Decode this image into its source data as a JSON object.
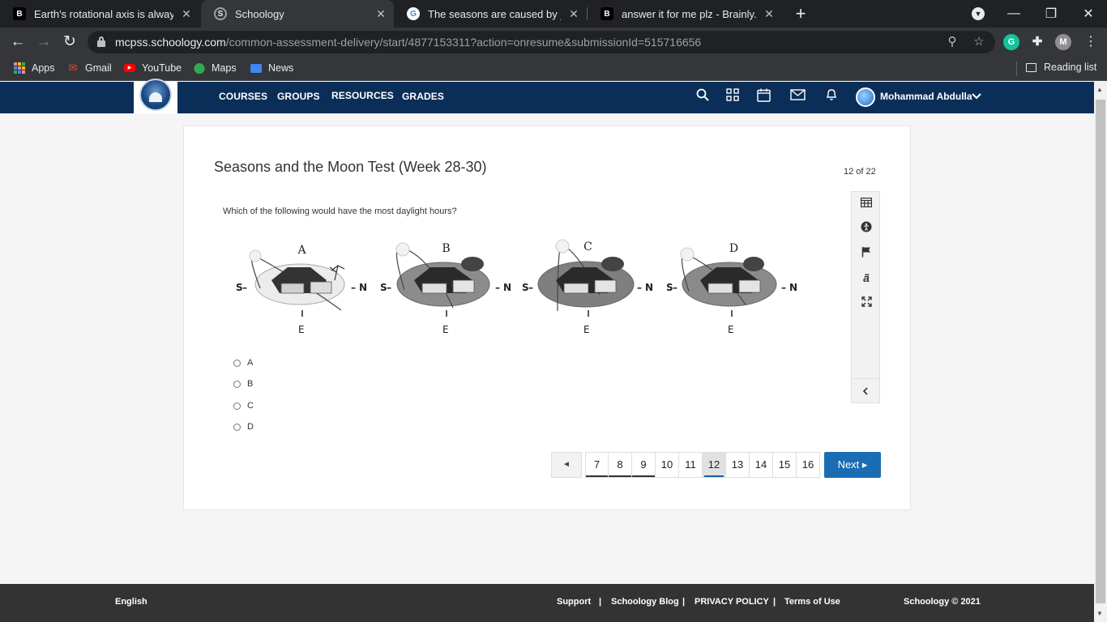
{
  "browser": {
    "tabs": [
      {
        "title": "Earth's rotational axis is always ti",
        "favicon": "brainly-icon"
      },
      {
        "title": "Schoology",
        "favicon": "schoology-icon"
      },
      {
        "title": "The seasons are caused by _____",
        "favicon": "google-icon"
      },
      {
        "title": "answer it for me plz - Brainly.com",
        "favicon": "brainly-icon"
      }
    ],
    "active_tab": 1,
    "url_host": "mcpss.schoology.com",
    "url_path": "/common-assessment-delivery/start/4877153311?action=onresume&submissionId=515716656",
    "profile_initial": "M",
    "grammarly_initial": "G",
    "bookmarks": [
      {
        "label": "Apps"
      },
      {
        "label": "Gmail"
      },
      {
        "label": "YouTube"
      },
      {
        "label": "Maps"
      },
      {
        "label": "News"
      }
    ],
    "reading_list": "Reading list"
  },
  "header": {
    "nav": [
      "COURSES",
      "GROUPS",
      "RESOURCES",
      "GRADES"
    ],
    "user_name": "Mohammad Abdulla"
  },
  "assessment": {
    "title": "Seasons and the Moon Test (Week 28-30)",
    "progress": "12 of 22",
    "question": "Which of the following would have the most daylight hours?",
    "figure": {
      "panels": [
        "A",
        "B",
        "C",
        "D"
      ],
      "south": "S",
      "north": "N",
      "east": "E"
    },
    "options": [
      "A",
      "B",
      "C",
      "D"
    ],
    "pager": {
      "prev": "◄",
      "pages": [
        "7",
        "8",
        "9",
        "10",
        "11",
        "12",
        "13",
        "14",
        "15",
        "16"
      ],
      "current": "12",
      "next": "Next ▸"
    }
  },
  "footer": {
    "language": "English",
    "links": [
      "Support",
      "Schoology Blog",
      "PRIVACY POLICY",
      "Terms of Use"
    ],
    "separator": "|",
    "copyright": "Schoology © 2021"
  },
  "colors": {
    "header_bg": "#0a2e58",
    "next_button": "#1a6db3",
    "footer_bg": "#333333"
  }
}
